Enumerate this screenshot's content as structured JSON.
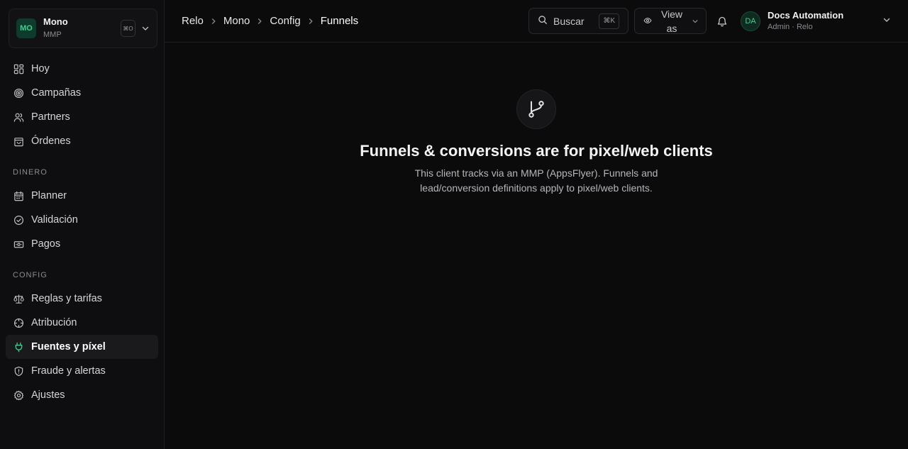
{
  "org": {
    "initials": "MO",
    "name": "Mono",
    "subtitle": "MMP",
    "shortcut": "⌘O"
  },
  "nav": {
    "items_top": [
      {
        "label": "Hoy",
        "icon": "dashboard-icon"
      },
      {
        "label": "Campañas",
        "icon": "target-icon"
      },
      {
        "label": "Partners",
        "icon": "users-icon"
      },
      {
        "label": "Órdenes",
        "icon": "shopping-bag-icon"
      }
    ],
    "section_money": "DINERO",
    "items_money": [
      {
        "label": "Planner",
        "icon": "calendar-icon"
      },
      {
        "label": "Validación",
        "icon": "check-circle-icon"
      },
      {
        "label": "Pagos",
        "icon": "banknote-icon"
      }
    ],
    "section_config": "CONFIG",
    "items_config": [
      {
        "label": "Reglas y tarifas",
        "icon": "scale-icon"
      },
      {
        "label": "Atribución",
        "icon": "crosshair-icon"
      },
      {
        "label": "Fuentes y píxel",
        "icon": "plug-icon",
        "active": true
      },
      {
        "label": "Fraude y alertas",
        "icon": "shield-icon"
      },
      {
        "label": "Ajustes",
        "icon": "gear-icon"
      }
    ]
  },
  "breadcrumb": [
    "Relo",
    "Mono",
    "Config",
    "Funnels"
  ],
  "search": {
    "label": "Buscar",
    "shortcut": "⌘K"
  },
  "view_as": {
    "label": "View as"
  },
  "user": {
    "initials": "DA",
    "name": "Docs Automation",
    "role": "Admin · Relo"
  },
  "empty_state": {
    "icon": "git-branch-icon",
    "title": "Funnels & conversions are for pixel/web clients",
    "description": "This client tracks via an MMP (AppsFlyer). Funnels and lead/conversion definitions apply to pixel/web clients."
  },
  "colors": {
    "accent": "#3ecf8e",
    "background": "#0b0b0c",
    "sidebar": "#0e0e10"
  }
}
